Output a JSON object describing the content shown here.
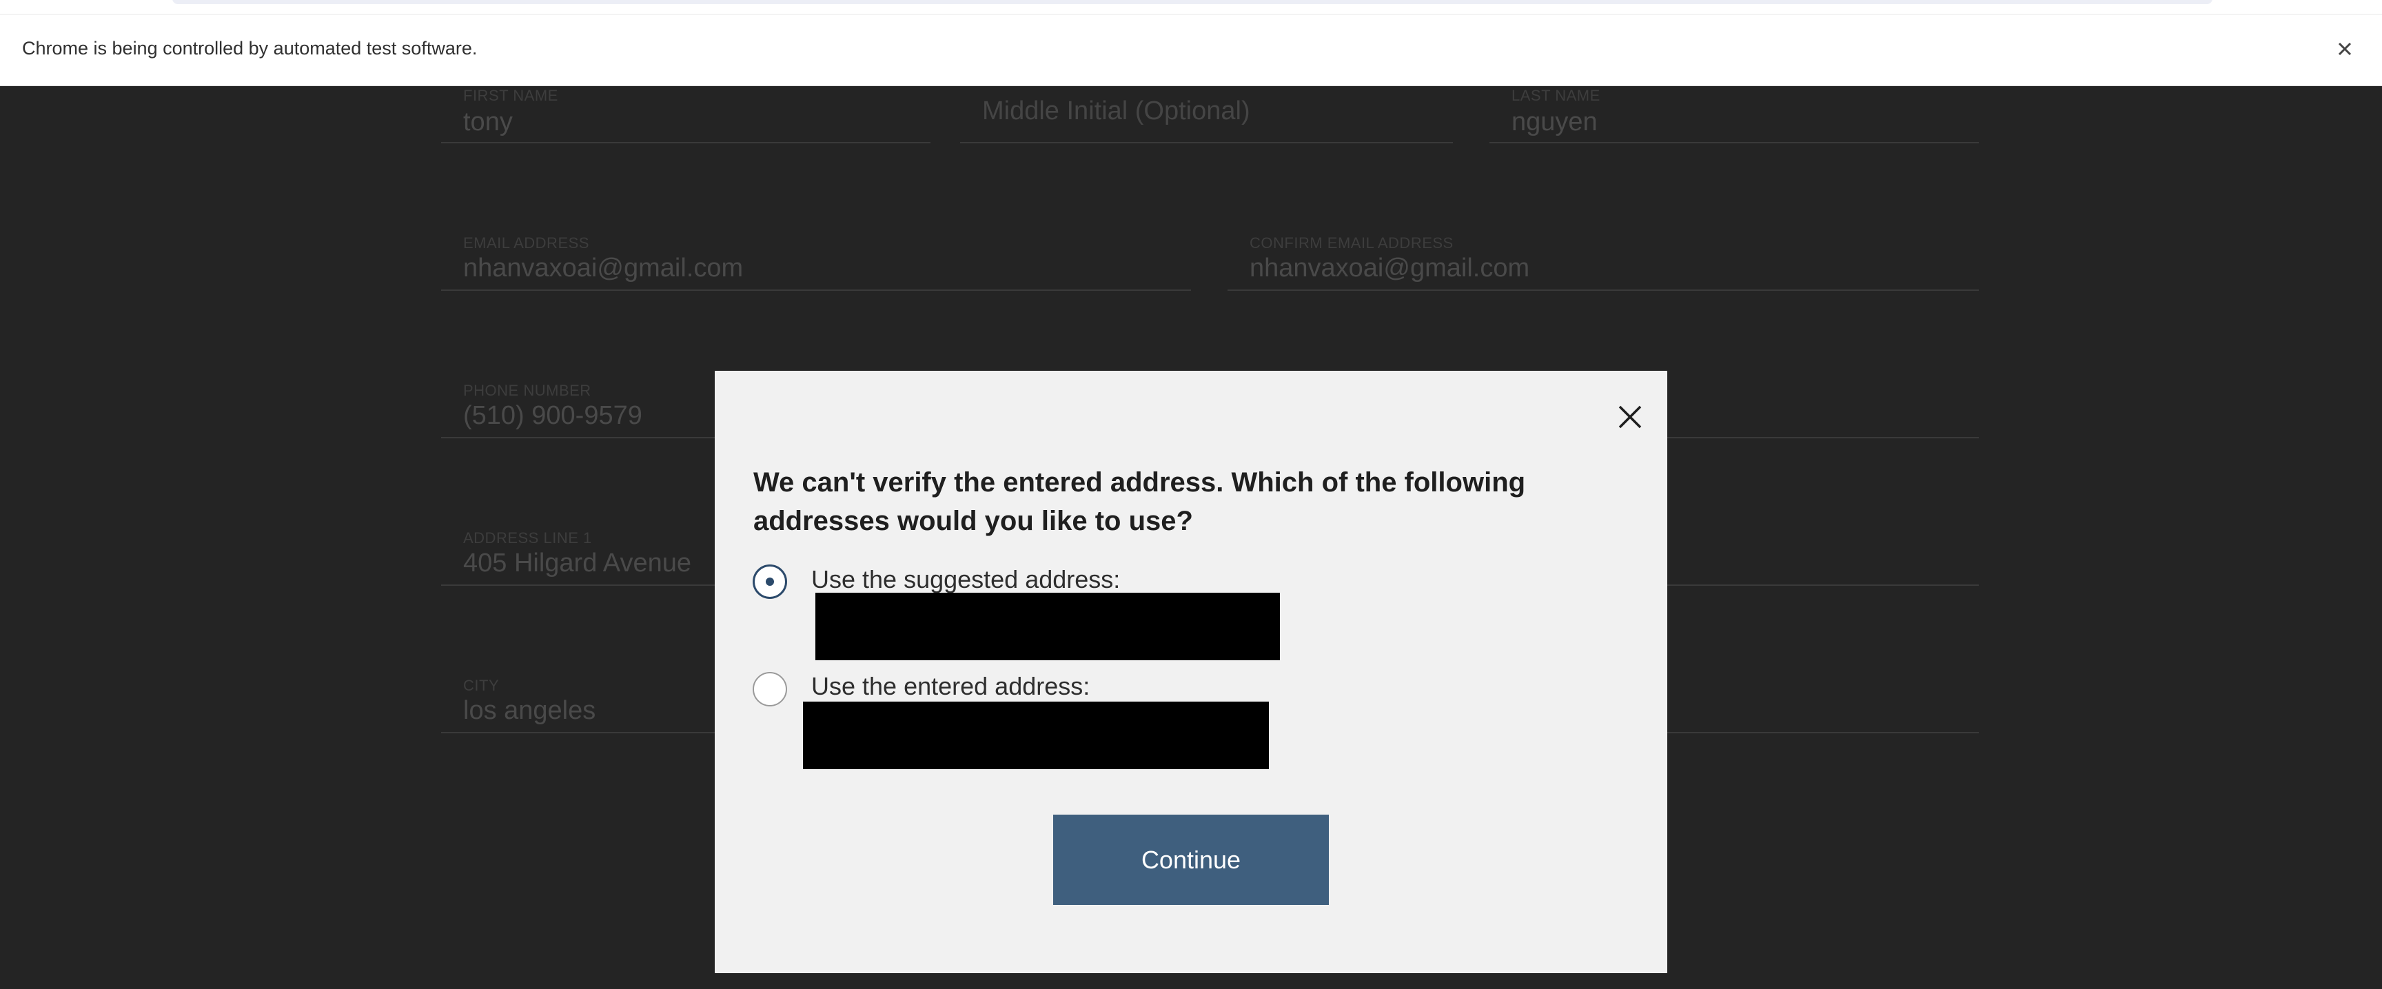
{
  "browser": {
    "infobar_message": "Chrome is being controlled by automated test software."
  },
  "form": {
    "first_name": {
      "label": "FIRST NAME",
      "value": "tony"
    },
    "middle_initial": {
      "placeholder": "Middle Initial (Optional)"
    },
    "last_name": {
      "label": "LAST NAME",
      "value": "nguyen"
    },
    "email": {
      "label": "EMAIL ADDRESS",
      "value": "nhanvaxoai@gmail.com"
    },
    "confirm_email": {
      "label": "CONFIRM EMAIL ADDRESS",
      "value": "nhanvaxoai@gmail.com"
    },
    "phone": {
      "label": "PHONE NUMBER",
      "value": "(510) 900-9579"
    },
    "address_line_1": {
      "label": "ADDRESS LINE 1",
      "value": "405 Hilgard Avenue"
    },
    "city": {
      "label": "CITY",
      "value": "los angeles"
    }
  },
  "modal": {
    "title": "We can't verify the entered address. Which of the following addresses would you like to use?",
    "options": [
      {
        "label": "Use the suggested address:",
        "selected": true
      },
      {
        "label": "Use the entered address:",
        "selected": false
      }
    ],
    "continue_label": "Continue"
  },
  "colors": {
    "overlay": "#242424",
    "modal_bg": "#f1f1f1",
    "accent": "#3f5f7e",
    "radio_selected": "#2c4a6b"
  },
  "icons": {
    "infobar_close": "close-icon",
    "modal_close": "close-icon"
  }
}
